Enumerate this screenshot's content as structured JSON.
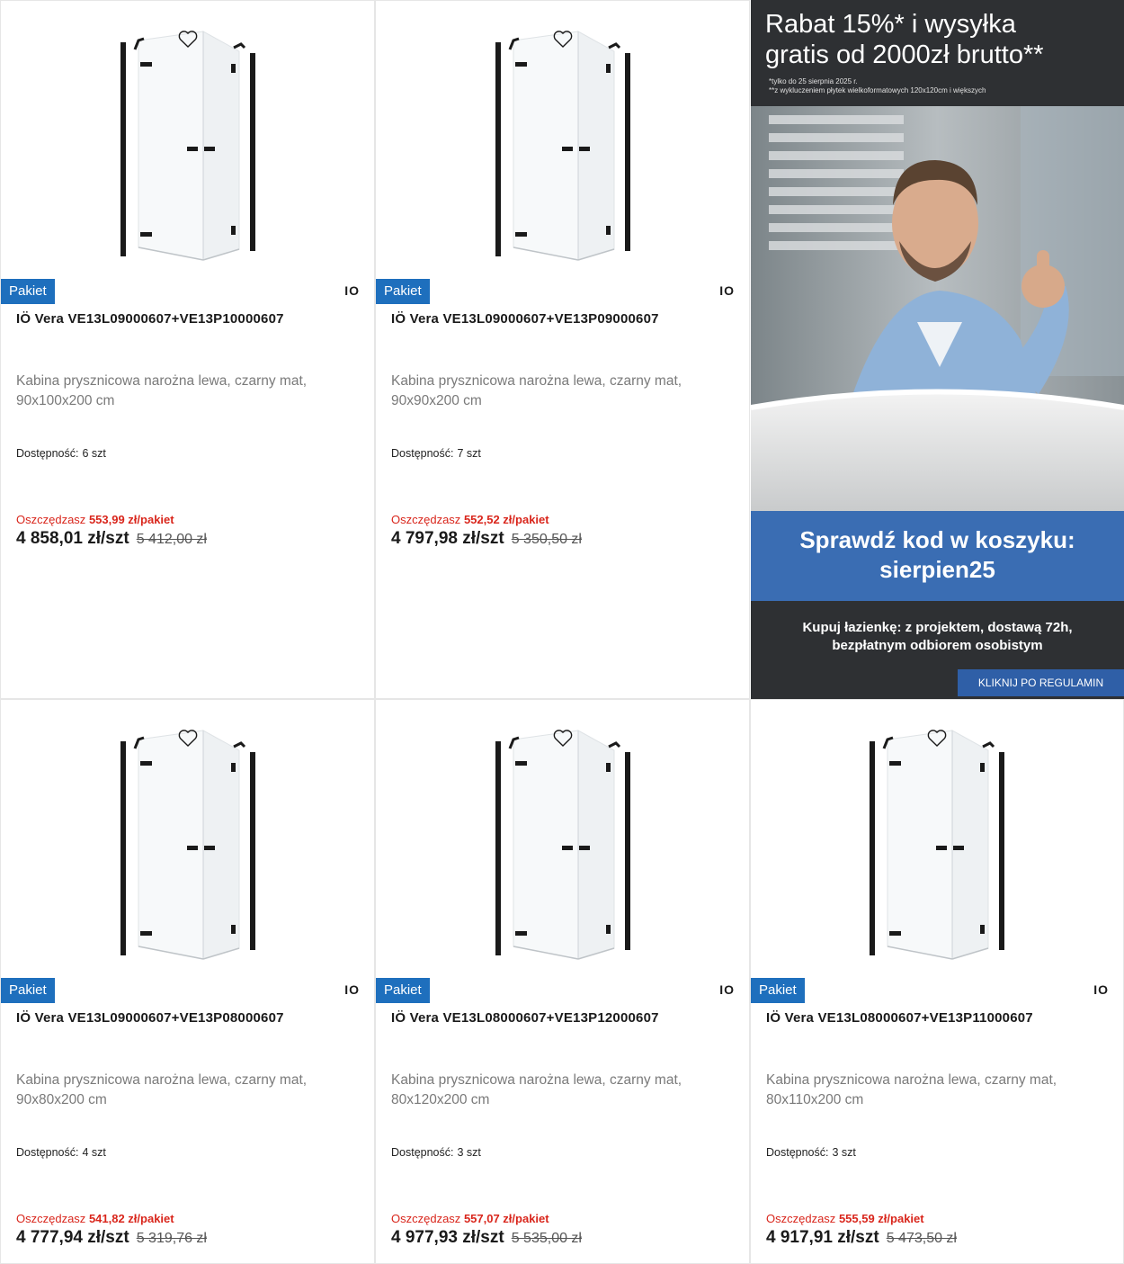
{
  "products": [
    {
      "badge": "Pakiet",
      "brand": "IO",
      "title": "IÖ Vera VE13L09000607+VE13P10000607",
      "desc": "Kabina prysznicowa narożna lewa, czarny mat, 90x100x200 cm",
      "avail_label": "Dostępność:",
      "avail_value": "6 szt",
      "save_label": "Oszczędzasz",
      "save_value": "553,99 zł/pakiet",
      "price": "4 858,01 zł/szt",
      "old_price": "5 412,00 zł"
    },
    {
      "badge": "Pakiet",
      "brand": "IO",
      "title": "IÖ Vera VE13L09000607+VE13P09000607",
      "desc": "Kabina prysznicowa narożna lewa, czarny mat, 90x90x200 cm",
      "avail_label": "Dostępność:",
      "avail_value": "7 szt",
      "save_label": "Oszczędzasz",
      "save_value": "552,52 zł/pakiet",
      "price": "4 797,98 zł/szt",
      "old_price": "5 350,50 zł"
    },
    {
      "badge": "Pakiet",
      "brand": "IO",
      "title": "IÖ Vera VE13L09000607+VE13P08000607",
      "desc": "Kabina prysznicowa narożna lewa, czarny mat, 90x80x200 cm",
      "avail_label": "Dostępność:",
      "avail_value": "4 szt",
      "save_label": "Oszczędzasz",
      "save_value": "541,82 zł/pakiet",
      "price": "4 777,94 zł/szt",
      "old_price": "5 319,76 zł"
    },
    {
      "badge": "Pakiet",
      "brand": "IO",
      "title": "IÖ Vera VE13L08000607+VE13P12000607",
      "desc": "Kabina prysznicowa narożna lewa, czarny mat, 80x120x200 cm",
      "avail_label": "Dostępność:",
      "avail_value": "3 szt",
      "save_label": "Oszczędzasz",
      "save_value": "557,07 zł/pakiet",
      "price": "4 977,93 zł/szt",
      "old_price": "5 535,00 zł"
    },
    {
      "badge": "Pakiet",
      "brand": "IO",
      "title": "IÖ Vera VE13L08000607+VE13P11000607",
      "desc": "Kabina prysznicowa narożna lewa, czarny mat, 80x110x200 cm",
      "avail_label": "Dostępność:",
      "avail_value": "3 szt",
      "save_label": "Oszczędzasz",
      "save_value": "555,59 zł/pakiet",
      "price": "4 917,91 zł/szt",
      "old_price": "5 473,50 zł"
    }
  ],
  "banner": {
    "headline_1": "Rabat 15%* i wysyłka",
    "headline_2": "gratis od 2000zł brutto**",
    "note_1": "*tylko do 25 sierpnia 2025 r.",
    "note_2": "**z wykluczeniem płytek wielkoformatowych 120x120cm i większych",
    "code_line_1": "Sprawdź kod w koszyku:",
    "code_line_2": "sierpien25",
    "info_line_1": "Kupuj łazienkę: z projektem, dostawą 72h,",
    "info_line_2": "bezpłatnym odbiorem osobistym",
    "button": "KLIKNIJ PO REGULAMIN"
  },
  "icons": {
    "favorite": "heart-outline-icon",
    "product_image": "shower-cabin-image"
  },
  "colors": {
    "badge": "#1e6fbd",
    "save": "#d9261c",
    "banner_blue": "#3a6db3"
  }
}
